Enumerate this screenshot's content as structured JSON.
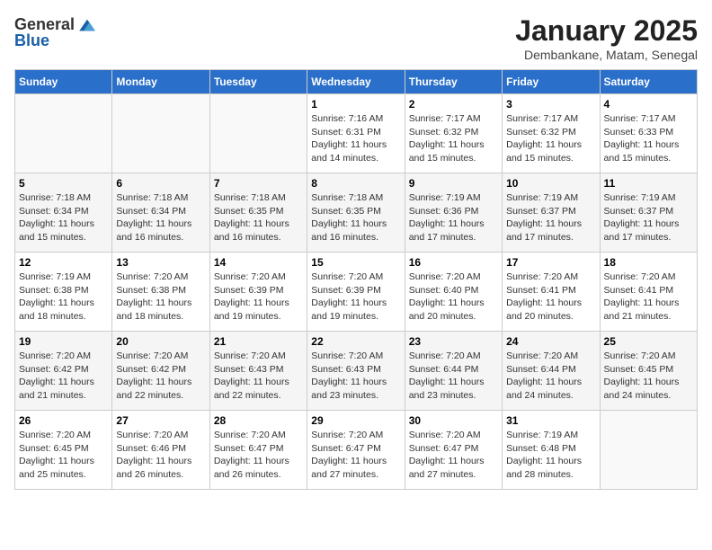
{
  "header": {
    "logo_general": "General",
    "logo_blue": "Blue",
    "month": "January 2025",
    "location": "Dembankane, Matam, Senegal"
  },
  "weekdays": [
    "Sunday",
    "Monday",
    "Tuesday",
    "Wednesday",
    "Thursday",
    "Friday",
    "Saturday"
  ],
  "weeks": [
    [
      {
        "day": "",
        "info": ""
      },
      {
        "day": "",
        "info": ""
      },
      {
        "day": "",
        "info": ""
      },
      {
        "day": "1",
        "info": "Sunrise: 7:16 AM\nSunset: 6:31 PM\nDaylight: 11 hours and 14 minutes."
      },
      {
        "day": "2",
        "info": "Sunrise: 7:17 AM\nSunset: 6:32 PM\nDaylight: 11 hours and 15 minutes."
      },
      {
        "day": "3",
        "info": "Sunrise: 7:17 AM\nSunset: 6:32 PM\nDaylight: 11 hours and 15 minutes."
      },
      {
        "day": "4",
        "info": "Sunrise: 7:17 AM\nSunset: 6:33 PM\nDaylight: 11 hours and 15 minutes."
      }
    ],
    [
      {
        "day": "5",
        "info": "Sunrise: 7:18 AM\nSunset: 6:34 PM\nDaylight: 11 hours and 15 minutes."
      },
      {
        "day": "6",
        "info": "Sunrise: 7:18 AM\nSunset: 6:34 PM\nDaylight: 11 hours and 16 minutes."
      },
      {
        "day": "7",
        "info": "Sunrise: 7:18 AM\nSunset: 6:35 PM\nDaylight: 11 hours and 16 minutes."
      },
      {
        "day": "8",
        "info": "Sunrise: 7:18 AM\nSunset: 6:35 PM\nDaylight: 11 hours and 16 minutes."
      },
      {
        "day": "9",
        "info": "Sunrise: 7:19 AM\nSunset: 6:36 PM\nDaylight: 11 hours and 17 minutes."
      },
      {
        "day": "10",
        "info": "Sunrise: 7:19 AM\nSunset: 6:37 PM\nDaylight: 11 hours and 17 minutes."
      },
      {
        "day": "11",
        "info": "Sunrise: 7:19 AM\nSunset: 6:37 PM\nDaylight: 11 hours and 17 minutes."
      }
    ],
    [
      {
        "day": "12",
        "info": "Sunrise: 7:19 AM\nSunset: 6:38 PM\nDaylight: 11 hours and 18 minutes."
      },
      {
        "day": "13",
        "info": "Sunrise: 7:20 AM\nSunset: 6:38 PM\nDaylight: 11 hours and 18 minutes."
      },
      {
        "day": "14",
        "info": "Sunrise: 7:20 AM\nSunset: 6:39 PM\nDaylight: 11 hours and 19 minutes."
      },
      {
        "day": "15",
        "info": "Sunrise: 7:20 AM\nSunset: 6:39 PM\nDaylight: 11 hours and 19 minutes."
      },
      {
        "day": "16",
        "info": "Sunrise: 7:20 AM\nSunset: 6:40 PM\nDaylight: 11 hours and 20 minutes."
      },
      {
        "day": "17",
        "info": "Sunrise: 7:20 AM\nSunset: 6:41 PM\nDaylight: 11 hours and 20 minutes."
      },
      {
        "day": "18",
        "info": "Sunrise: 7:20 AM\nSunset: 6:41 PM\nDaylight: 11 hours and 21 minutes."
      }
    ],
    [
      {
        "day": "19",
        "info": "Sunrise: 7:20 AM\nSunset: 6:42 PM\nDaylight: 11 hours and 21 minutes."
      },
      {
        "day": "20",
        "info": "Sunrise: 7:20 AM\nSunset: 6:42 PM\nDaylight: 11 hours and 22 minutes."
      },
      {
        "day": "21",
        "info": "Sunrise: 7:20 AM\nSunset: 6:43 PM\nDaylight: 11 hours and 22 minutes."
      },
      {
        "day": "22",
        "info": "Sunrise: 7:20 AM\nSunset: 6:43 PM\nDaylight: 11 hours and 23 minutes."
      },
      {
        "day": "23",
        "info": "Sunrise: 7:20 AM\nSunset: 6:44 PM\nDaylight: 11 hours and 23 minutes."
      },
      {
        "day": "24",
        "info": "Sunrise: 7:20 AM\nSunset: 6:44 PM\nDaylight: 11 hours and 24 minutes."
      },
      {
        "day": "25",
        "info": "Sunrise: 7:20 AM\nSunset: 6:45 PM\nDaylight: 11 hours and 24 minutes."
      }
    ],
    [
      {
        "day": "26",
        "info": "Sunrise: 7:20 AM\nSunset: 6:45 PM\nDaylight: 11 hours and 25 minutes."
      },
      {
        "day": "27",
        "info": "Sunrise: 7:20 AM\nSunset: 6:46 PM\nDaylight: 11 hours and 26 minutes."
      },
      {
        "day": "28",
        "info": "Sunrise: 7:20 AM\nSunset: 6:47 PM\nDaylight: 11 hours and 26 minutes."
      },
      {
        "day": "29",
        "info": "Sunrise: 7:20 AM\nSunset: 6:47 PM\nDaylight: 11 hours and 27 minutes."
      },
      {
        "day": "30",
        "info": "Sunrise: 7:20 AM\nSunset: 6:47 PM\nDaylight: 11 hours and 27 minutes."
      },
      {
        "day": "31",
        "info": "Sunrise: 7:19 AM\nSunset: 6:48 PM\nDaylight: 11 hours and 28 minutes."
      },
      {
        "day": "",
        "info": ""
      }
    ]
  ]
}
